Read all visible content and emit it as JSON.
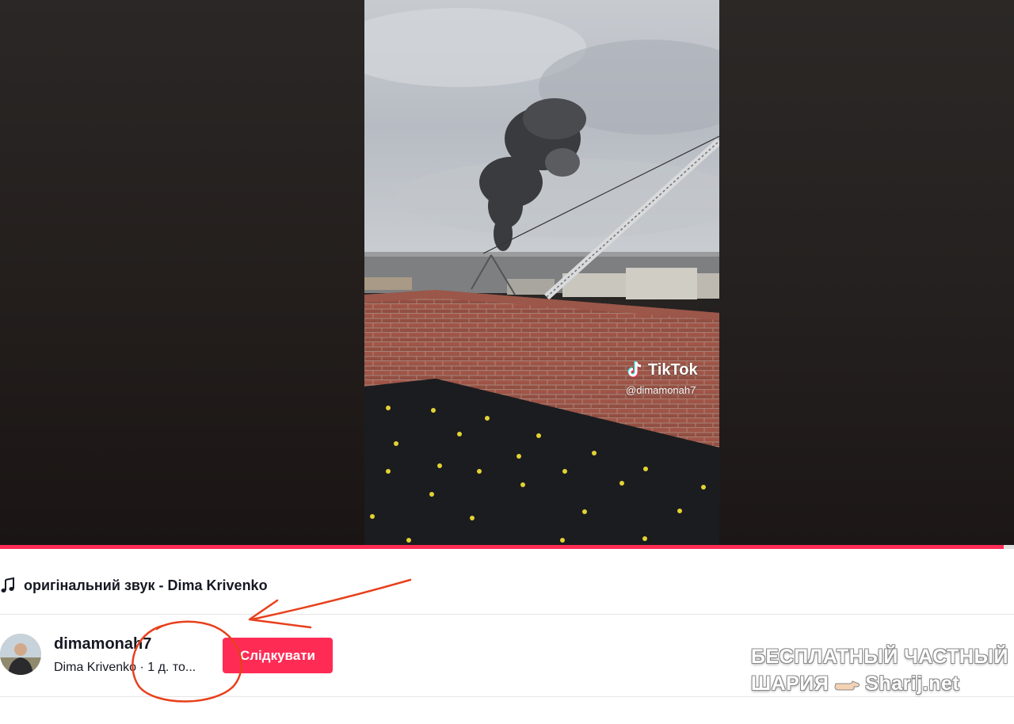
{
  "video": {
    "tiktok_logo": "TikTok",
    "watermark_handle": "@dimamonah7",
    "progress": 0.99
  },
  "sound": {
    "icon": "music-note-icon",
    "label": "оригінальний звук - Dima Krivenko"
  },
  "author": {
    "username": "dimamonah7",
    "subline": "Dima Krivenko · 1 д. то...",
    "follow_label": "Слідкувати"
  },
  "stamp": {
    "line1": "БЕСПЛАТНЫЙ ЧАСТНЫЙ",
    "line2_left": "ШАРИЯ",
    "line2_right": "Sharij.net"
  },
  "colors": {
    "accent": "#fe2c55",
    "annotation": "#e8401c"
  }
}
